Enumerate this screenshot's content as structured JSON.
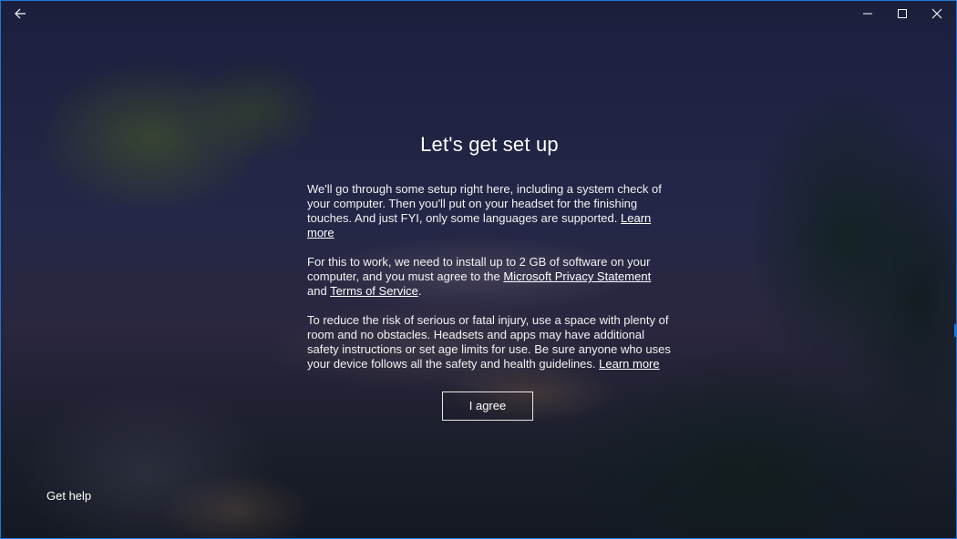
{
  "titlebar": {
    "back_icon": "back-arrow-icon",
    "minimize_icon": "minimize-icon",
    "maximize_icon": "maximize-icon",
    "close_icon": "close-icon"
  },
  "main": {
    "title": "Let's get set up",
    "p1": {
      "text": "We'll go through some setup right here, including a system check of your computer. Then you'll put on your headset for the finishing touches. And just FYI, only some languages are supported. ",
      "link": "Learn more"
    },
    "p2": {
      "text_before": "For this to work, we need to install up to 2 GB of software on your computer, and you must agree to the ",
      "privacy_link": "Microsoft Privacy Statement",
      "text_middle": " and ",
      "terms_link": "Terms of Service",
      "text_after": "."
    },
    "p3": {
      "text": "To reduce the risk of serious or fatal injury, use a space with plenty of room and no obstacles. Headsets and apps may have additional safety instructions or set age limits for use. Be sure anyone who uses your device follows all the safety and health guidelines. ",
      "link": "Learn more"
    },
    "agree_button": "I agree"
  },
  "footer": {
    "help_link": "Get help"
  },
  "colors": {
    "window_border": "#1e78d7",
    "text": "#ffffff"
  }
}
